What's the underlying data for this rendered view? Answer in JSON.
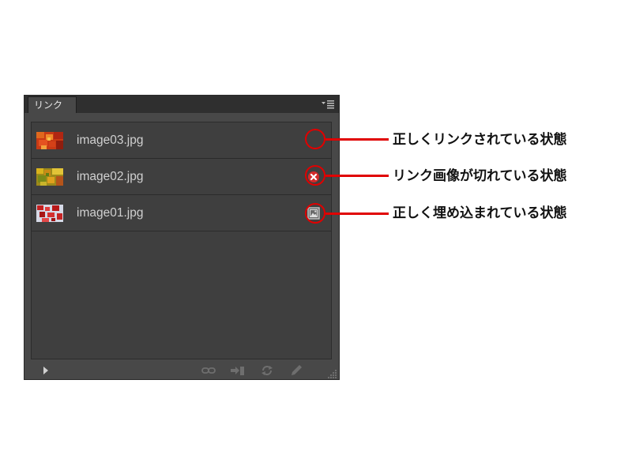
{
  "panel": {
    "tab_label": "リンク",
    "menu_icon": "panel-menu-icon",
    "links": [
      {
        "filename": "image03.jpg",
        "status": "linked-ok",
        "status_icon": "none"
      },
      {
        "filename": "image02.jpg",
        "status": "missing",
        "status_icon": "missing-link-icon"
      },
      {
        "filename": "image01.jpg",
        "status": "embedded",
        "status_icon": "embedded-icon"
      }
    ],
    "bottom_toolbar": [
      "expand-arrow-icon",
      "relink-icon",
      "go-to-link-icon",
      "update-link-icon",
      "edit-original-icon",
      "resize-grip-icon"
    ]
  },
  "annotations": [
    {
      "text": "正しくリンクされている状態"
    },
    {
      "text": "リンク画像が切れている状態"
    },
    {
      "text": "正しく埋め込まれている状態"
    }
  ],
  "colors": {
    "annotation_red": "#e00000",
    "panel_bg": "#484848",
    "list_bg": "#3f3f3f"
  }
}
